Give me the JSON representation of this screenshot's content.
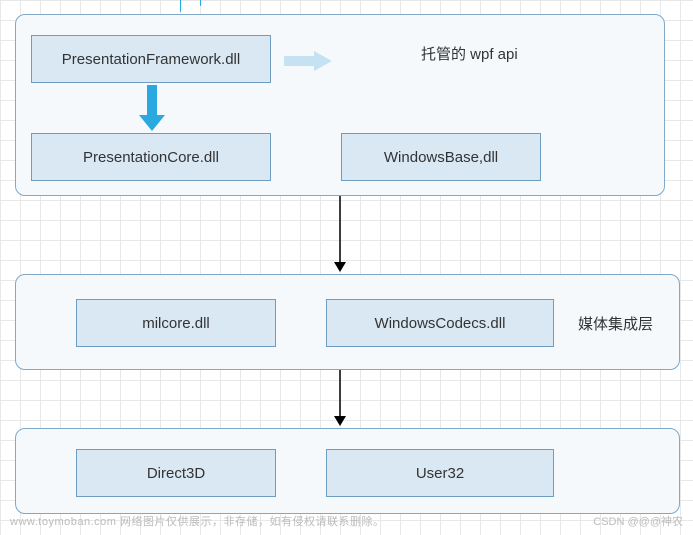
{
  "layer1": {
    "label": "托管的  wpf api",
    "nodes": {
      "presentation_framework": "PresentationFramework.dll",
      "presentation_core": "PresentationCore.dll",
      "windows_base": "WindowsBase,dll"
    }
  },
  "layer2": {
    "label": "媒体集成层",
    "nodes": {
      "milcore": "milcore.dll",
      "windows_codecs": "WindowsCodecs.dll"
    }
  },
  "layer3": {
    "nodes": {
      "direct3d": "Direct3D",
      "user32": "User32"
    }
  },
  "watermark": {
    "left": "www.toymoban.com  网络图片仅供展示，非存储，如有侵权请联系删除。",
    "right": "CSDN @@@神农"
  }
}
